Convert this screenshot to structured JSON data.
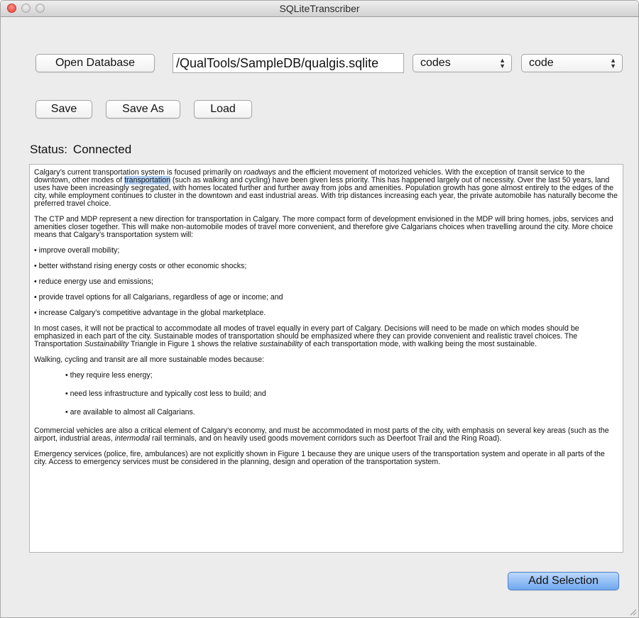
{
  "window": {
    "title": "SQLiteTranscriber"
  },
  "toolbar": {
    "open_database": "Open Database",
    "db_path": "/QualTools/SampleDB/qualgis.sqlite",
    "table_select": "codes",
    "column_select": "code",
    "save": "Save",
    "save_as": "Save As",
    "load": "Load"
  },
  "status": {
    "label": "Status:",
    "value": "Connected"
  },
  "document": {
    "p1_a": "Calgary’s current transportation system is focused primarily on ",
    "p1_em": "roadways",
    "p1_b": " and the efficient movement of motorized vehicles. With the exception of transit service to the downtown, other modes of ",
    "p1_sel": "transportation",
    "p1_c": " (such as walking and cycling) have been given less priority. This has happened largely out of necessity. Over the last 50 years, land uses have been increasingly segregated, with homes located further and further away from jobs and amenities. Population growth has gone almost entirely to the edges of the city, while employment continues to cluster in the downtown and east industrial areas. With trip distances increasing each year, the private automobile has naturally become the preferred travel choice.",
    "p2": "The CTP and MDP represent a new direction for transportation in Calgary. The more compact form of development envisioned in the MDP will bring homes, jobs, services and amenities closer together. This will make non-automobile modes of travel more convenient, and therefore give Calgarians choices when travelling around the city. More choice means that Calgary’s transportation system will:",
    "bullets": [
      "• improve overall mobility;",
      "• better withstand rising energy costs or other economic shocks;",
      "• reduce energy use and emissions;",
      "• provide travel options for all Calgarians, regardless of age or income; and",
      "• increase Calgary’s competitive advantage in the global marketplace."
    ],
    "p3_a": "In most cases, it will not be practical to accommodate all modes of travel equally in every part of Calgary. Decisions will need to be made on which modes should be emphasized in each part of the city. Sustainable modes of transportation should be emphasized where they can provide convenient and realistic travel choices. The Transportation ",
    "p3_em1": "Sustainability",
    "p3_b": " Triangle in Figure 1 shows the relative ",
    "p3_em2": "sustainability",
    "p3_c": " of each transportation mode, with walking being the most sustainable.",
    "p4": "Walking, cycling and transit are all more sustainable modes because:",
    "sub_bullets": [
      "• they require less energy;",
      "• need less infrastructure and typically cost less to build; and",
      "• are available to almost all Calgarians."
    ],
    "p5_a": "Commercial vehicles are also a critical element of Calgary’s economy, and must be accommodated in most parts of the city, with emphasis on several key areas (such as the airport, industrial areas, ",
    "p5_em": "intermodal",
    "p5_b": " rail terminals, and on heavily used goods movement corridors such as Deerfoot Trail and the Ring Road).",
    "p6": "Emergency services (police, fire, ambulances) are not explicitly shown in Figure 1 because they are unique users of the transportation system and operate in all parts of the city. Access to emergency services must be considered in the planning, design and operation of the transportation system."
  },
  "actions": {
    "add_selection": "Add Selection"
  }
}
